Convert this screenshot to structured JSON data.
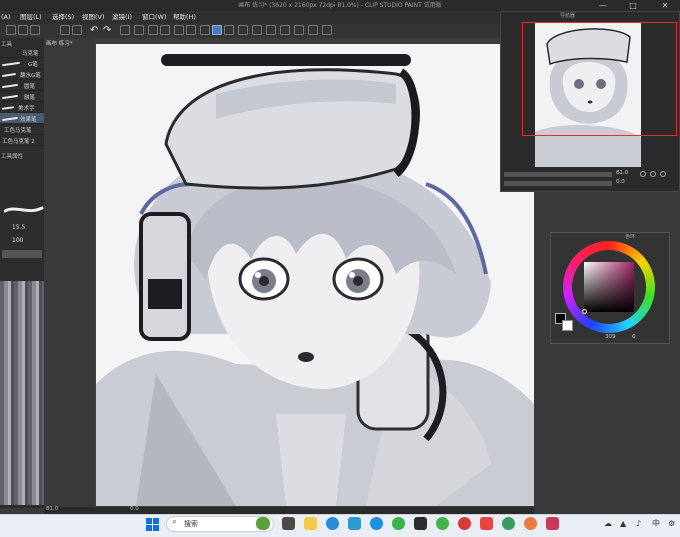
{
  "window": {
    "title": "画布 练习* (3620 x 2160px 72dpi 81.0%)  - CLIP STUDIO PAINT 试用版",
    "minimize_glyph": "—",
    "maximize_glyph": "□",
    "close_glyph": "✕"
  },
  "menu": {
    "items": [
      "(A)",
      "图层(L)",
      "选择(S)",
      "视图(V)",
      "滤镜(I)",
      "窗口(W)",
      "帮助(H)"
    ]
  },
  "document_tab": {
    "label": "画布 练习*"
  },
  "tool_panel": {
    "title": "工具",
    "brushes": [
      "马克笔",
      "G笔",
      "蘸水G笔",
      "圆笔",
      "融笔",
      "美术字",
      "效果笔",
      "工色马克笔",
      "工色马克笔 2"
    ],
    "selected_index": 6,
    "property_title": "工具属性",
    "size_value": "15.5",
    "opacity_value": "100"
  },
  "status": {
    "zoom": "81.0",
    "zoom_right": "0.0"
  },
  "navigator": {
    "title": "导航器",
    "zoom": "81.0",
    "angle": "0.0"
  },
  "color": {
    "title": "色环",
    "hue_color": "#a22466",
    "value_readout": "309",
    "value2": "0"
  },
  "taskbar": {
    "search_placeholder": "搜索",
    "ime_label": "中",
    "icons": [
      "windows-start-icon",
      "search-icon",
      "file-explorer-icon",
      "folder-icon",
      "edge-browser-icon",
      "store-icon",
      "edge-icon",
      "wechat-icon",
      "app-icon",
      "music-icon",
      "netease-icon",
      "red-app-icon",
      "chrome-icon",
      "colorful-icon",
      "paint-app-icon"
    ]
  }
}
